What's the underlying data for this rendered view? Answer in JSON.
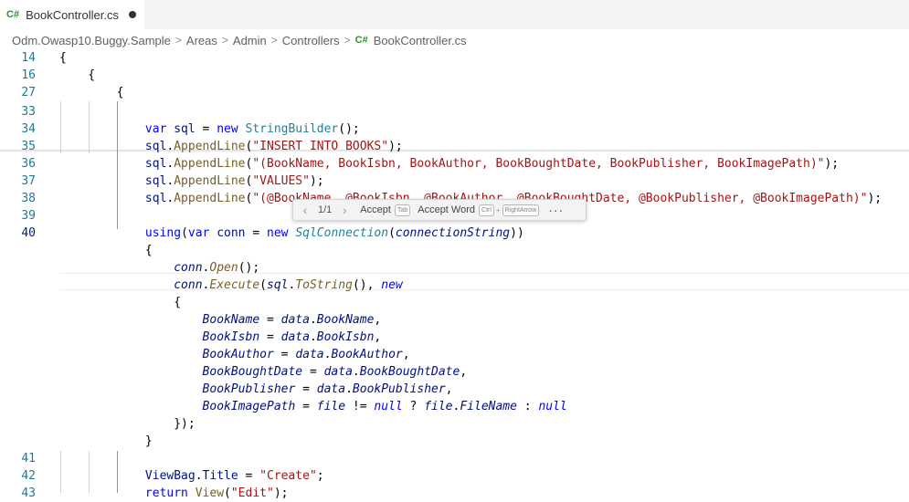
{
  "tab": {
    "lang_icon": "C#",
    "title": "BookController.cs",
    "dirty_indicator": "dot-icon"
  },
  "breadcrumb": {
    "items": [
      "Odm.Owasp10.Buggy.Sample",
      "Areas",
      "Admin",
      "Controllers"
    ],
    "file_icon": "C#",
    "file": "BookController.cs"
  },
  "editor": {
    "active_line": "40",
    "lines": [
      {
        "n": "14",
        "code": "{"
      },
      {
        "n": "16",
        "code": "    {"
      },
      {
        "n": "27",
        "code": "        {"
      },
      {
        "n": "33",
        "code": ""
      },
      {
        "n": "34",
        "code": "            var sql = new StringBuilder();"
      },
      {
        "n": "35",
        "code": "            sql.AppendLine(\"INSERT INTO BOOKS\");"
      },
      {
        "n": "36",
        "code": "            sql.AppendLine(\"(BookName, BookIsbn, BookAuthor, BookBoughtDate, BookPublisher, BookImagePath)\");"
      },
      {
        "n": "37",
        "code": "            sql.AppendLine(\"VALUES\");"
      },
      {
        "n": "38",
        "code": "            sql.AppendLine(\"(@BookName, @BookIsbn, @BookAuthor, @BookBoughtDate, @BookPublisher, @BookImagePath)\");"
      },
      {
        "n": "39",
        "code": ""
      },
      {
        "n": "40",
        "code": "            using(var conn = new SqlConnection(connectionString))"
      },
      {
        "n": "",
        "code": "            {"
      },
      {
        "n": "",
        "code": "                conn.Open();"
      },
      {
        "n": "",
        "code": "                conn.Execute(sql.ToString(), new"
      },
      {
        "n": "",
        "code": "                {"
      },
      {
        "n": "",
        "code": "                    BookName = data.BookName,"
      },
      {
        "n": "",
        "code": "                    BookIsbn = data.BookIsbn,"
      },
      {
        "n": "",
        "code": "                    BookAuthor = data.BookAuthor,"
      },
      {
        "n": "",
        "code": "                    BookBoughtDate = data.BookBoughtDate,"
      },
      {
        "n": "",
        "code": "                    BookPublisher = data.BookPublisher,"
      },
      {
        "n": "",
        "code": "                    BookImagePath = file != null ? file.FileName : null"
      },
      {
        "n": "",
        "code": "                });"
      },
      {
        "n": "",
        "code": "            }"
      },
      {
        "n": "41",
        "code": ""
      },
      {
        "n": "42",
        "code": "            ViewBag.Title = \"Create\";"
      },
      {
        "n": "43",
        "code": "            return View(\"Edit\");"
      }
    ]
  },
  "inline_suggestion_toolbar": {
    "prev": "‹",
    "counter": "1/1",
    "next": "›",
    "accept_label": "Accept",
    "accept_key": "Tab",
    "accept_word_label": "Accept Word",
    "accept_word_key1": "Ctrl",
    "plus": "+",
    "accept_word_key2": "RightArrow",
    "more": "···"
  }
}
